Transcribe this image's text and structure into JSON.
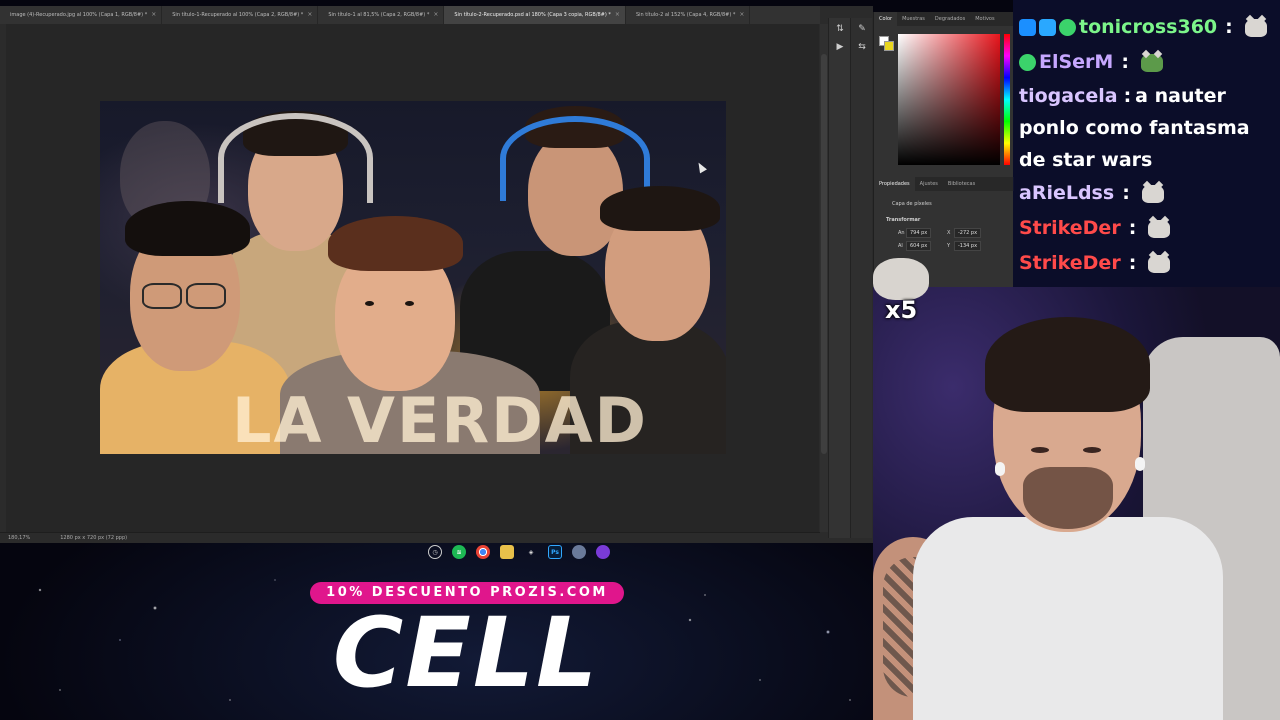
{
  "photoshop": {
    "tabs": [
      {
        "label": "image (4)-Recuperado.jpg al 100% (Capa 1, RGB/8#) *",
        "active": false
      },
      {
        "label": "Sin título-1-Recuperado al 100% (Capa 2, RGB/8#) *",
        "active": false
      },
      {
        "label": "Sin título-1 al 81,5% (Capa 2, RGB/8#) *",
        "active": false
      },
      {
        "label": "Sin título-2-Recuperado.psd al 180% (Capa 3 copia, RGB/8#) *",
        "active": true
      },
      {
        "label": "Sin título-2 al 152% (Capa 4, RGB/8#) *",
        "active": false
      }
    ],
    "status": {
      "zoom": "180,17%",
      "doc_size": "1280 px x 720 px (72 ppp)"
    },
    "thumbnail_title": "LA VERDAD",
    "panel": {
      "color_tabs": [
        "Color",
        "Muestras",
        "Degradados",
        "Motivos"
      ],
      "props_tabs": [
        "Propiedades",
        "Ajustes",
        "Bibliotecas"
      ],
      "layer_type": "Capa de píxeles",
      "section": "Transformar",
      "width_label": "An",
      "width": "794 px",
      "height_label": "Al",
      "height": "604 px",
      "x_label": "X",
      "x": "-272 px",
      "y_label": "Y",
      "y": "-134 px"
    }
  },
  "chat": [
    {
      "user": "tonicross360",
      "color": "#7CF58A",
      "text": "",
      "badges": [
        "#1b8fff",
        "#2aa8ff",
        "#3bd36b"
      ],
      "emote": true
    },
    {
      "user": "ElSerM",
      "color": "#C6A7FF",
      "text": "",
      "badges": [
        "#3bd36b"
      ],
      "emote": true
    },
    {
      "user": "tiogacela",
      "color": "#D9C5FF",
      "text": "a nauter ponlo como fantasma de star wars",
      "badges": [],
      "emote": false
    },
    {
      "user": "aRieLdss",
      "color": "#D9C5FF",
      "text": "",
      "badges": [],
      "emote": true
    },
    {
      "user": "StrikeDer",
      "color": "#FF4A4A",
      "text": "",
      "badges": [],
      "emote": true
    },
    {
      "user": "StrikeDer",
      "color": "#FF4A4A",
      "text": "",
      "badges": [],
      "emote": true
    }
  ],
  "alert": {
    "count": "x5"
  },
  "sponsor": {
    "promo": "10% DESCUENTO PROZIS.COM",
    "code": "CELL"
  },
  "colors": {
    "accent_pink": "#e0168c",
    "chat_bg": "#0e1030"
  }
}
